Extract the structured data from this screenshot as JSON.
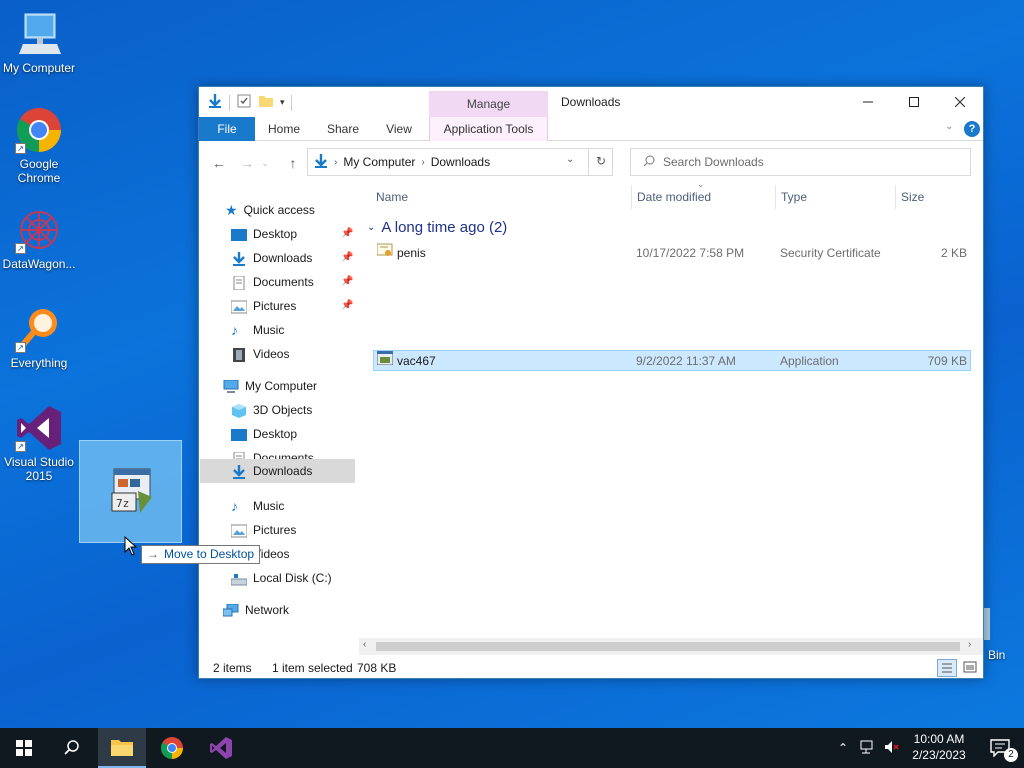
{
  "desktop": {
    "icons": [
      {
        "label": "My Computer"
      },
      {
        "label": "Google Chrome"
      },
      {
        "label": "DataWagon..."
      },
      {
        "label": "Everything"
      },
      {
        "label": "Visual Studio 2015"
      },
      {
        "label": "Bin"
      }
    ]
  },
  "drag": {
    "tooltip": "Move to Desktop"
  },
  "window": {
    "manage_tab": "Manage",
    "title": "Downloads",
    "tabs": {
      "file": "File",
      "home": "Home",
      "share": "Share",
      "view": "View",
      "app_tools": "Application Tools"
    },
    "address": {
      "root": "My Computer",
      "current": "Downloads"
    },
    "search": {
      "placeholder": "Search Downloads"
    },
    "nav": {
      "quick_access": "Quick access",
      "qa_items": [
        "Desktop",
        "Downloads",
        "Documents",
        "Pictures",
        "Music",
        "Videos"
      ],
      "my_computer": "My Computer",
      "pc_items": [
        "3D Objects",
        "Desktop",
        "Documents",
        "Downloads",
        "Music",
        "Pictures",
        "Videos",
        "Local Disk (C:)"
      ],
      "network": "Network"
    },
    "columns": {
      "name": "Name",
      "date": "Date modified",
      "type": "Type",
      "size": "Size"
    },
    "group": "A long time ago (2)",
    "files": [
      {
        "name": "penis",
        "date": "10/17/2022 7:58 PM",
        "type": "Security Certificate",
        "size": "2 KB"
      },
      {
        "name": "vac467",
        "date": "9/2/2022 11:37 AM",
        "type": "Application",
        "size": "709 KB"
      }
    ],
    "status": {
      "items": "2 items",
      "selected": "1 item selected",
      "size": "708 KB"
    }
  },
  "taskbar": {
    "time": "10:00 AM",
    "date": "2/23/2023",
    "notif_count": "2"
  }
}
